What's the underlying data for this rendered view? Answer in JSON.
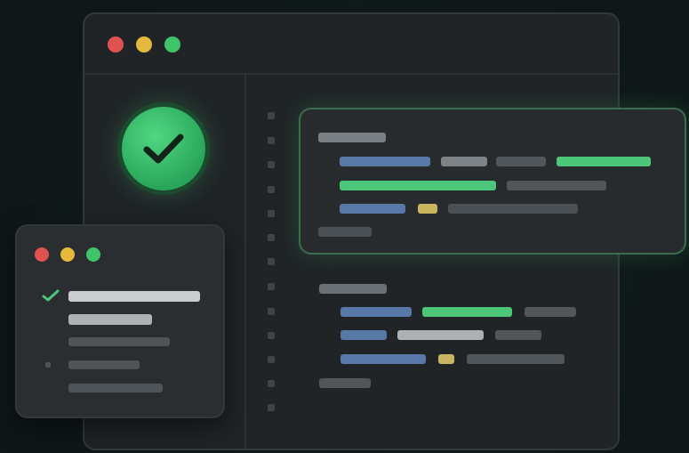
{
  "colors": {
    "close": "#e0524f",
    "minimize": "#e5b93b",
    "maximize": "#3fc469",
    "accent_green": "#4cc77a",
    "code_blue": "#5878a8",
    "code_gray": "#7d8287",
    "code_dark": "#565c60",
    "code_yellow": "#c9b460",
    "code_light": "#c9cdd0"
  },
  "icons": {
    "status": "checkmark-circle-icon",
    "small_status": "checkmark-icon"
  }
}
